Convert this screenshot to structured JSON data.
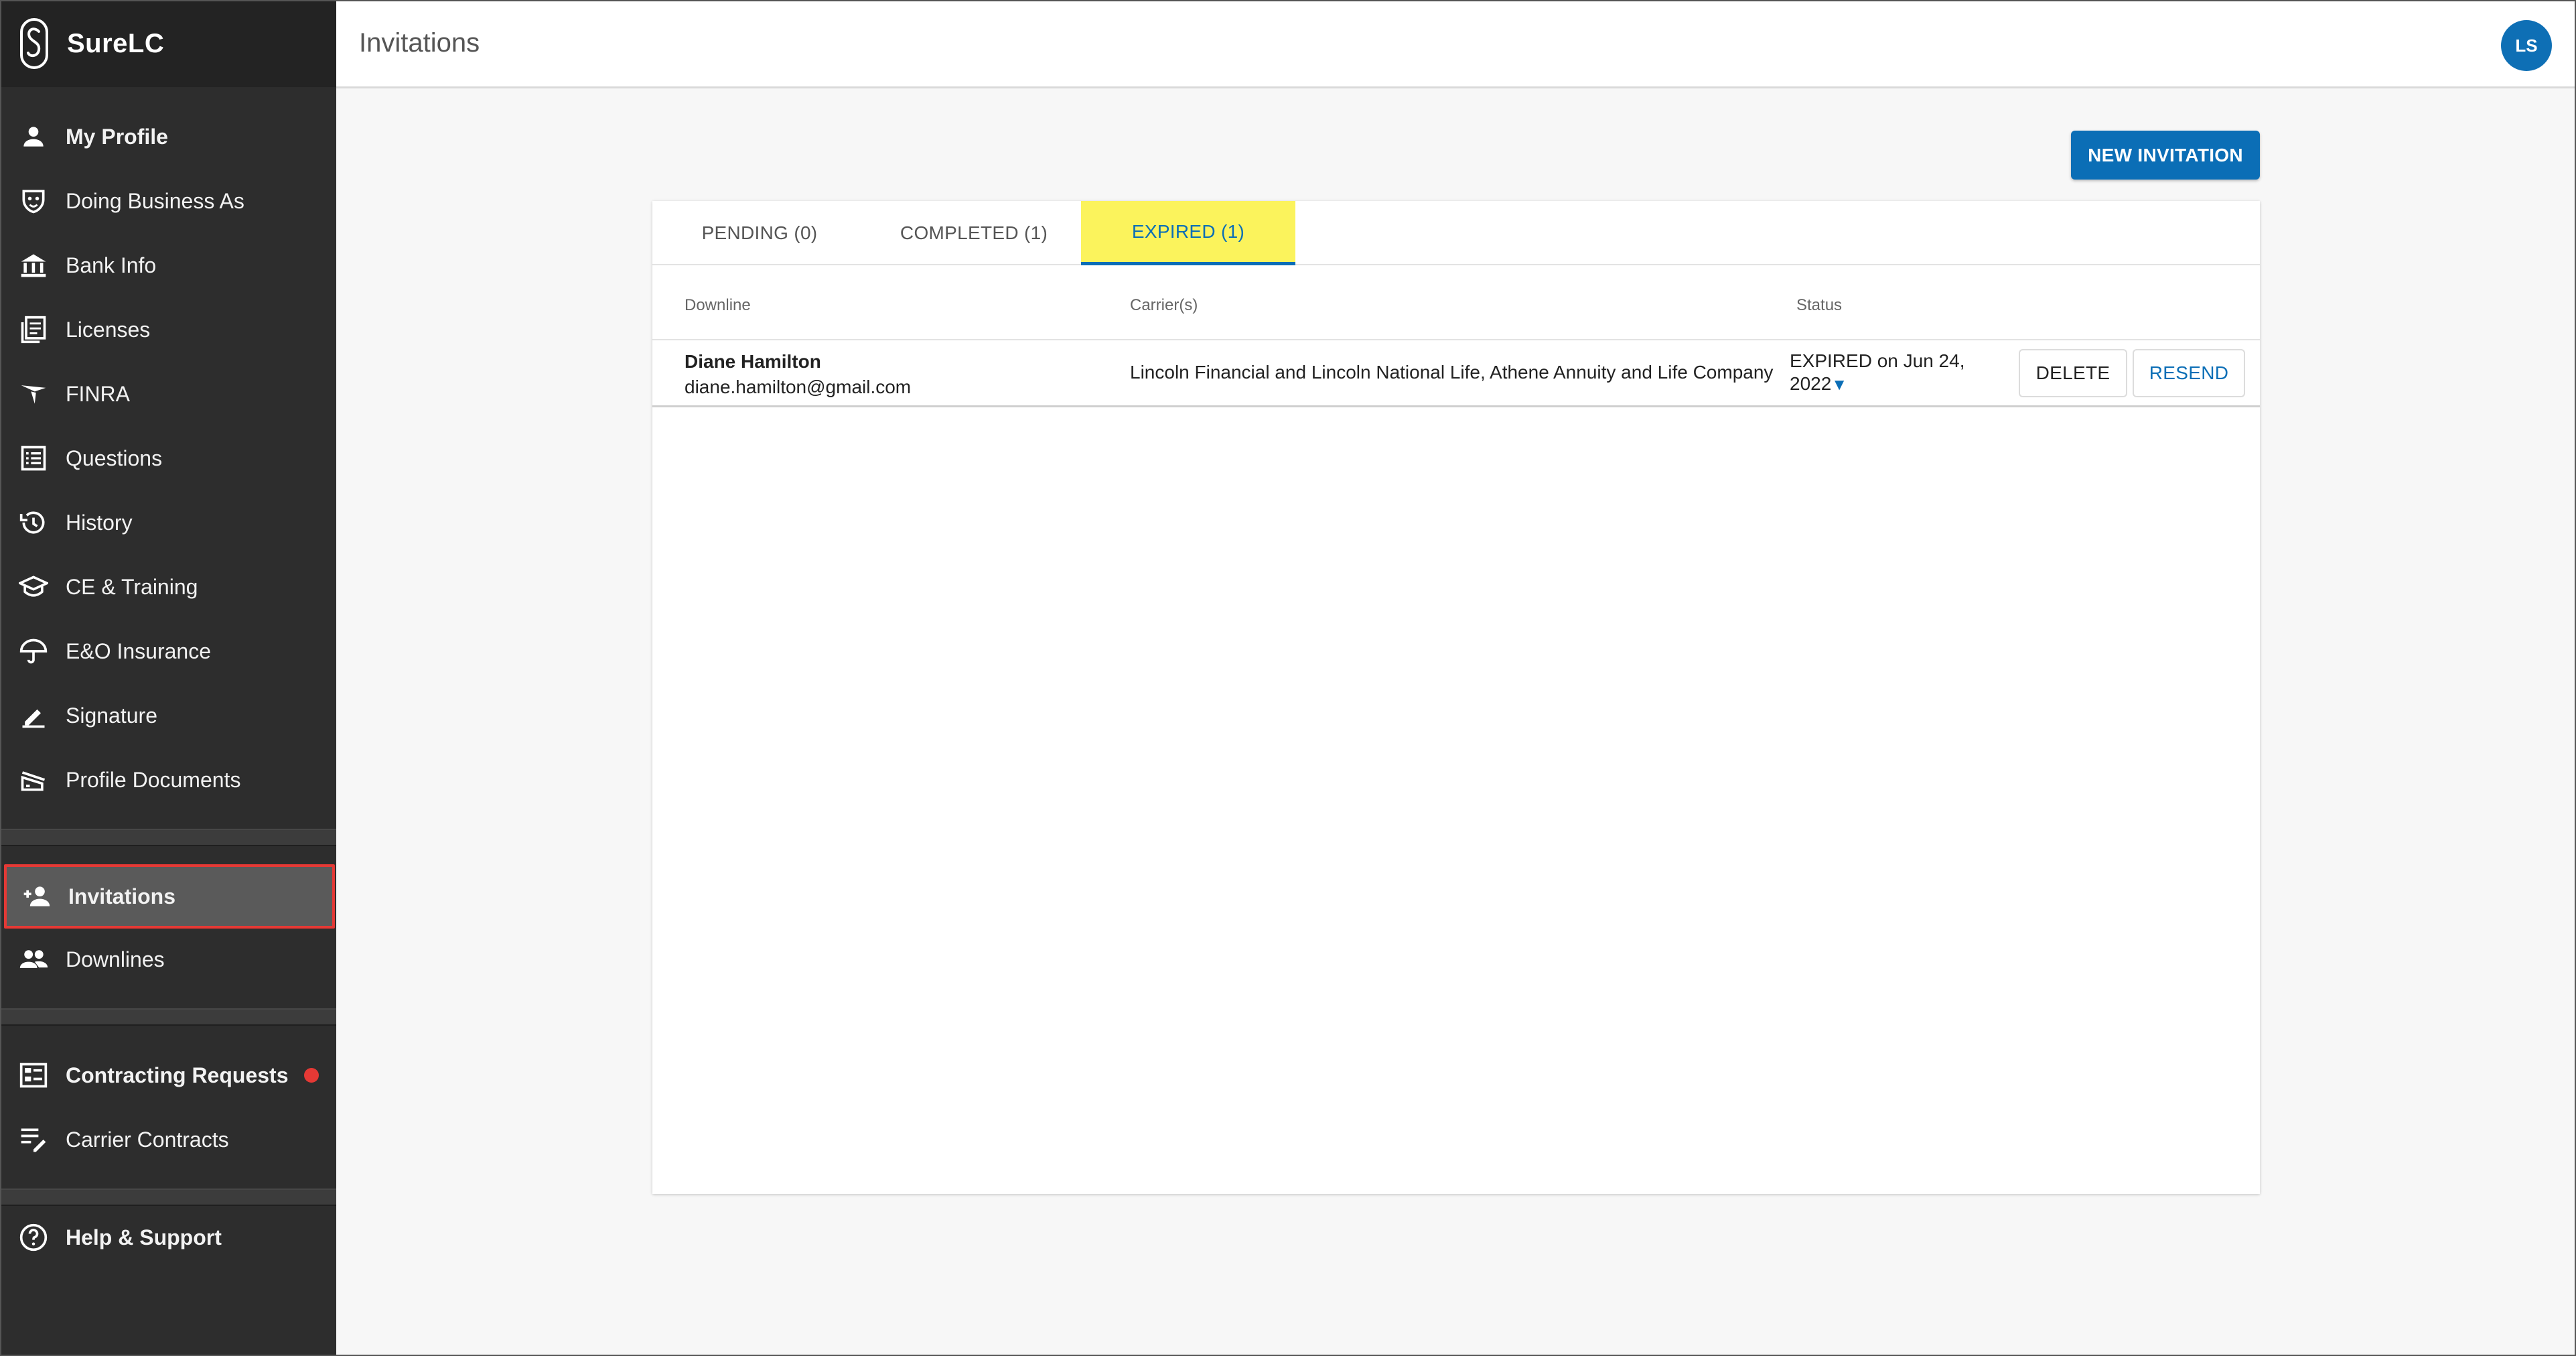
{
  "brand": {
    "name": "SureLC"
  },
  "sidebar": {
    "profile_items": [
      {
        "label": "My Profile",
        "icon": "person-icon"
      },
      {
        "label": "Doing Business As",
        "icon": "mask-icon"
      },
      {
        "label": "Bank Info",
        "icon": "bank-icon"
      },
      {
        "label": "Licenses",
        "icon": "document-stack-icon"
      },
      {
        "label": "FINRA",
        "icon": "finra-icon"
      },
      {
        "label": "Questions",
        "icon": "list-icon"
      },
      {
        "label": "History",
        "icon": "history-icon"
      },
      {
        "label": "CE & Training",
        "icon": "graduation-cap-icon"
      },
      {
        "label": "E&O Insurance",
        "icon": "umbrella-icon"
      },
      {
        "label": "Signature",
        "icon": "pen-icon"
      },
      {
        "label": "Profile Documents",
        "icon": "scanner-icon"
      }
    ],
    "invitations_label": "Invitations",
    "downlines_label": "Downlines",
    "contracting_requests_label": "Contracting Requests",
    "carrier_contracts_label": "Carrier Contracts",
    "help_label": "Help & Support",
    "notification_color": "#e53935"
  },
  "header": {
    "title": "Invitations",
    "avatar_initials": "LS"
  },
  "main": {
    "new_invitation_label": "NEW INVITATION",
    "tabs": [
      {
        "label": "PENDING (0)"
      },
      {
        "label": "COMPLETED (1)"
      },
      {
        "label": "EXPIRED (1)",
        "active": true
      }
    ],
    "columns": {
      "downline": "Downline",
      "carriers": "Carrier(s)",
      "status": "Status"
    },
    "rows": [
      {
        "name": "Diane Hamilton",
        "email": "diane.hamilton@gmail.com",
        "carriers": "Lincoln Financial and Lincoln National Life, Athene Annuity and Life Company",
        "status_line1": "EXPIRED on Jun 24,",
        "status_line2": "2022",
        "delete_label": "DELETE",
        "resend_label": "RESEND"
      }
    ]
  },
  "colors": {
    "accent": "#0b6eb6",
    "highlight": "#fbf35c",
    "sidebar_bg": "#2d2d2d"
  }
}
